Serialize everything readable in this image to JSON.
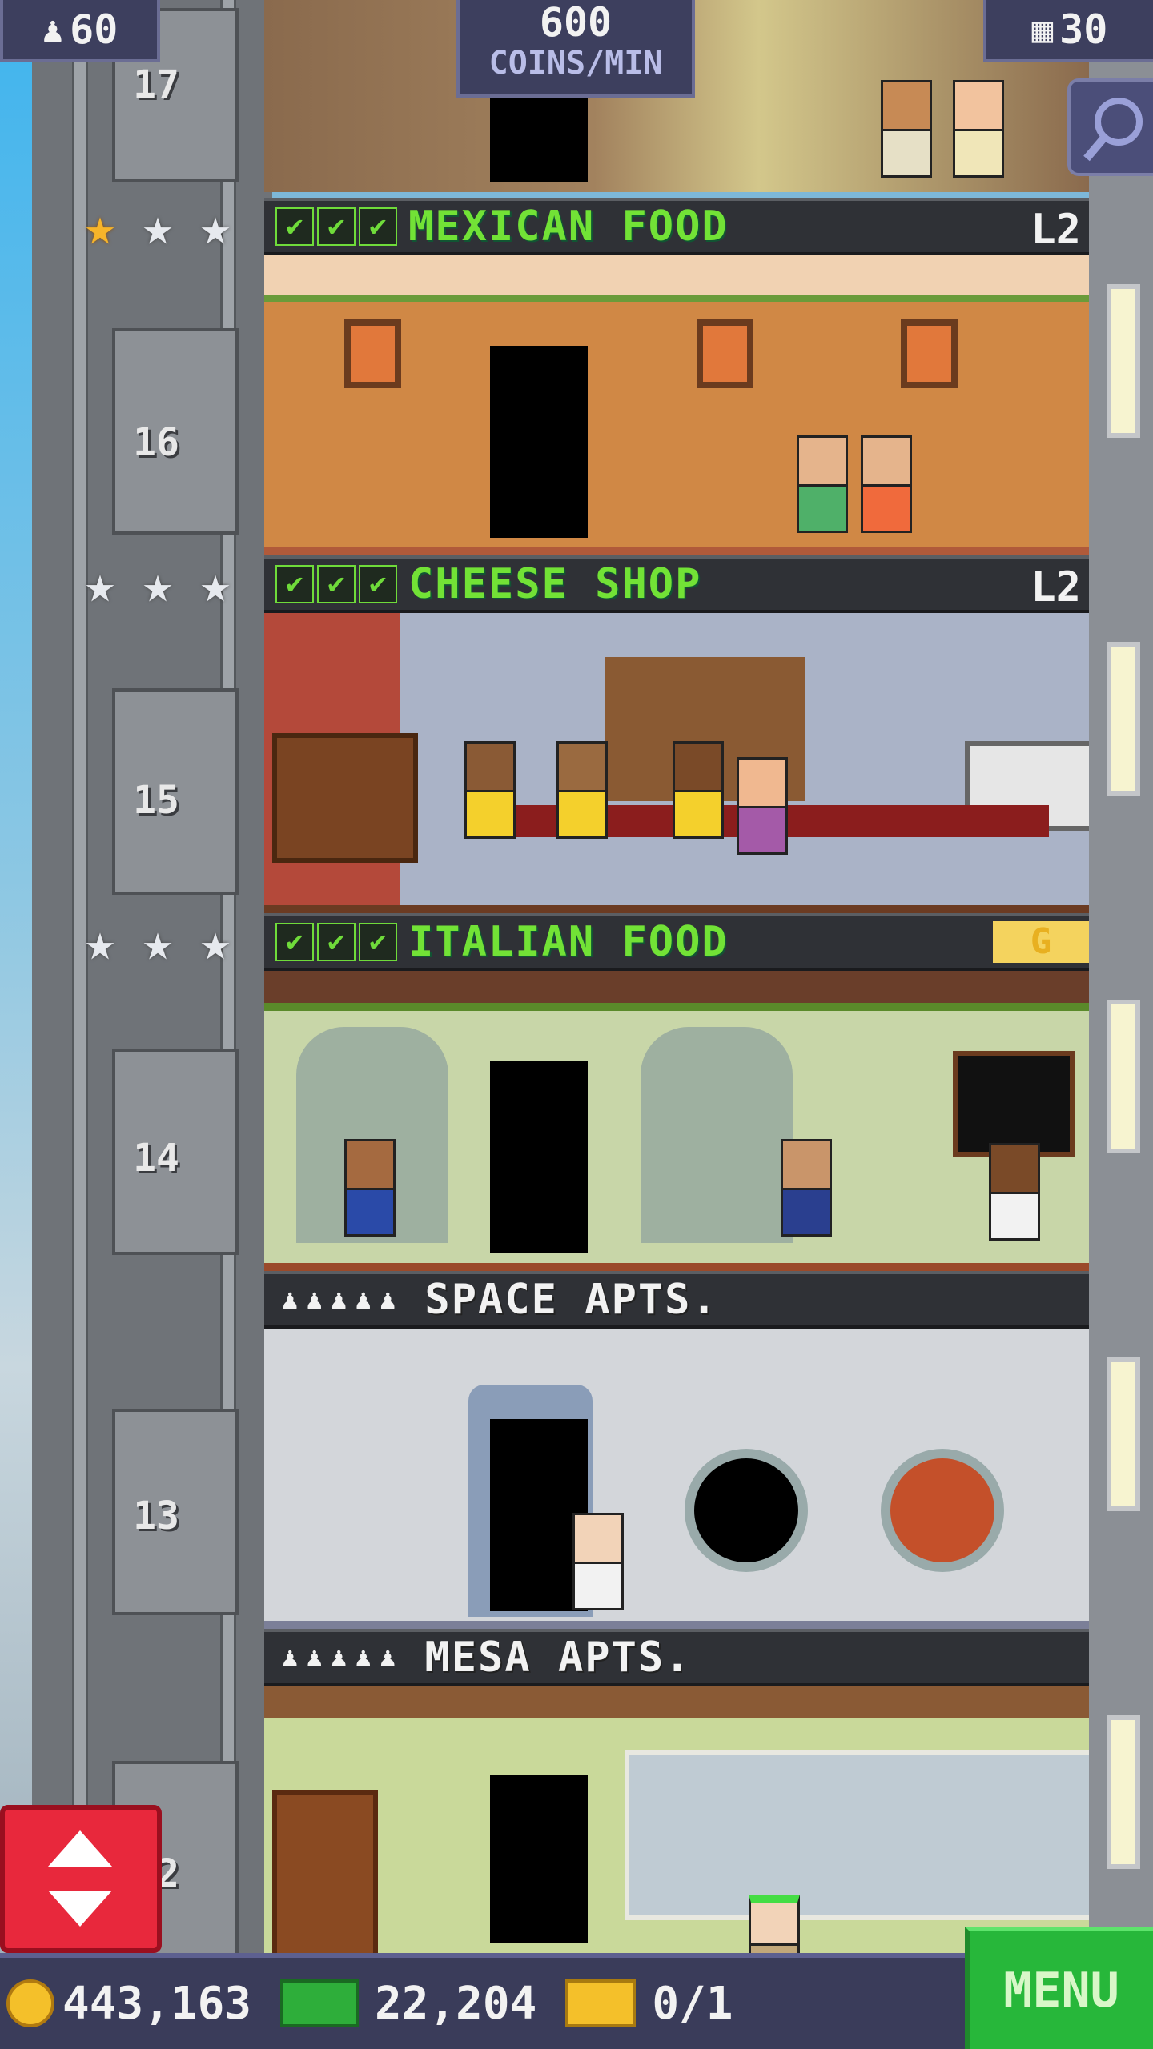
{
  "top_bar": {
    "population": "60",
    "coins_rate_value": "600",
    "coins_rate_unit": "COINS/MIN",
    "floors_count": "30"
  },
  "floors": [
    {
      "number": "17"
    },
    {
      "number": "16",
      "name": "MEXICAN FOOD",
      "level": "L2",
      "stars_gold": 1,
      "stars_total": 3
    },
    {
      "number": "15",
      "name": "CHEESE SHOP",
      "level": "L2",
      "stars_gold": 0,
      "stars_total": 3
    },
    {
      "number": "14",
      "name": "ITALIAN FOOD",
      "badge": "G",
      "stars_gold": 0,
      "stars_total": 3
    },
    {
      "number": "13",
      "name": "SPACE APTS.",
      "residents_icons": 5
    },
    {
      "number": "12",
      "name": "MESA APTS.",
      "residents_icons": 5
    }
  ],
  "check_mark": "✔",
  "person_glyph": "♟",
  "bottom_bar": {
    "coins": "443,163",
    "bux": "22,204",
    "tickets": "0/1",
    "menu_label": "MENU"
  },
  "icons": {
    "population": "person-icon",
    "floors": "building-icon",
    "zoom": "magnifier-icon",
    "coin": "coin-icon",
    "bux": "bux-icon",
    "ticket": "ticket-icon",
    "elevator": "elevator-arrows-icon"
  },
  "colors": {
    "banner_text_green": "#72e236",
    "menu_green": "#27b73a",
    "elevator_red": "#e8283c",
    "gold_star": "#f6b42a"
  }
}
